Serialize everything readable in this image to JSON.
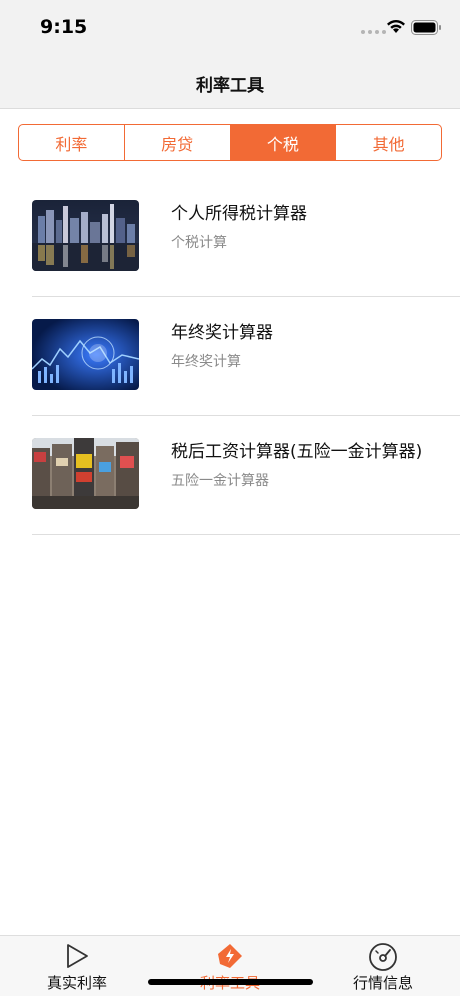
{
  "status": {
    "time": "9:15"
  },
  "nav": {
    "title": "利率工具"
  },
  "segments": [
    {
      "label": "利率",
      "active": false
    },
    {
      "label": "房贷",
      "active": false
    },
    {
      "label": "个税",
      "active": true
    },
    {
      "label": "其他",
      "active": false
    }
  ],
  "tools": [
    {
      "title": "个人所得税计算器",
      "subtitle": "个税计算",
      "thumbnail": "city-night-image"
    },
    {
      "title": "年终奖计算器",
      "subtitle": "年终奖计算",
      "thumbnail": "stock-chart-image"
    },
    {
      "title": "税后工资计算器(五险一金计算器)",
      "subtitle": "五险一金计算器",
      "thumbnail": "times-square-image"
    }
  ],
  "tabbar": [
    {
      "label": "真实利率",
      "icon": "play-triangle-icon",
      "active": false
    },
    {
      "label": "利率工具",
      "icon": "lightning-tag-icon",
      "active": true
    },
    {
      "label": "行情信息",
      "icon": "gauge-icon",
      "active": false
    }
  ],
  "colors": {
    "accent": "#f26a35",
    "background": "#ffffff",
    "bar": "#f2f2f2"
  }
}
